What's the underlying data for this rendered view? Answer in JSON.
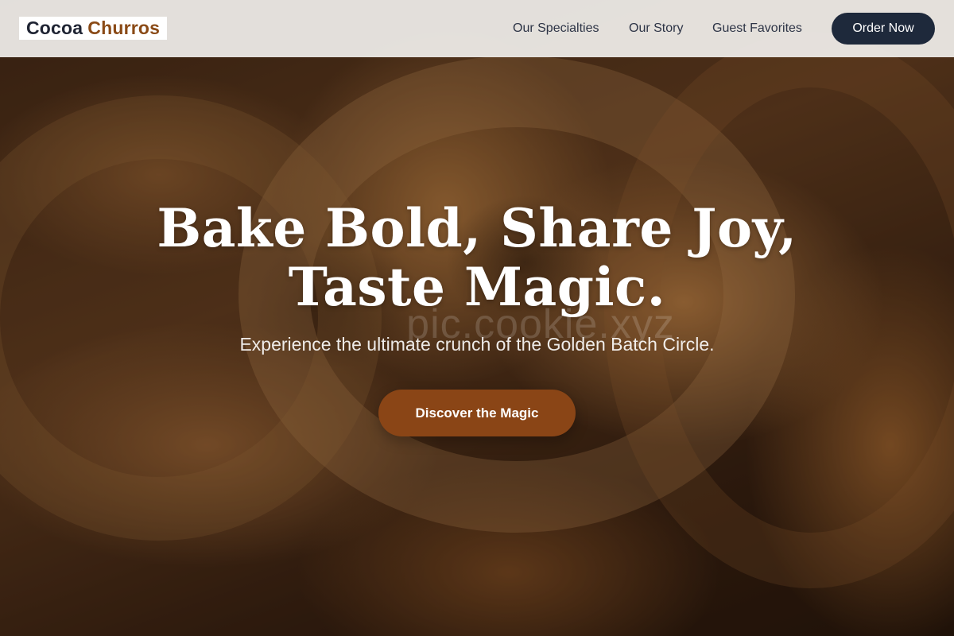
{
  "brand": {
    "word1": "Cocoa",
    "word2": "Churros",
    "accent_color": "#8a4a16",
    "dark_color": "#1f2433"
  },
  "nav": {
    "links": [
      "Our Specialties",
      "Our Story",
      "Guest Favorites"
    ],
    "order_button": "Order Now",
    "order_button_color": "#1e293b"
  },
  "hero": {
    "headline_line1": "Bake Bold, Share Joy,",
    "headline_line2": "Taste Magic.",
    "watermark": "pic.cookie.xyz",
    "subtitle": "Experience the ultimate crunch of the Golden Batch Circle.",
    "cta_label": "Discover the Magic",
    "cta_color": "#8a4516",
    "background_image": "sugar-coated-churro-ring-photo"
  }
}
